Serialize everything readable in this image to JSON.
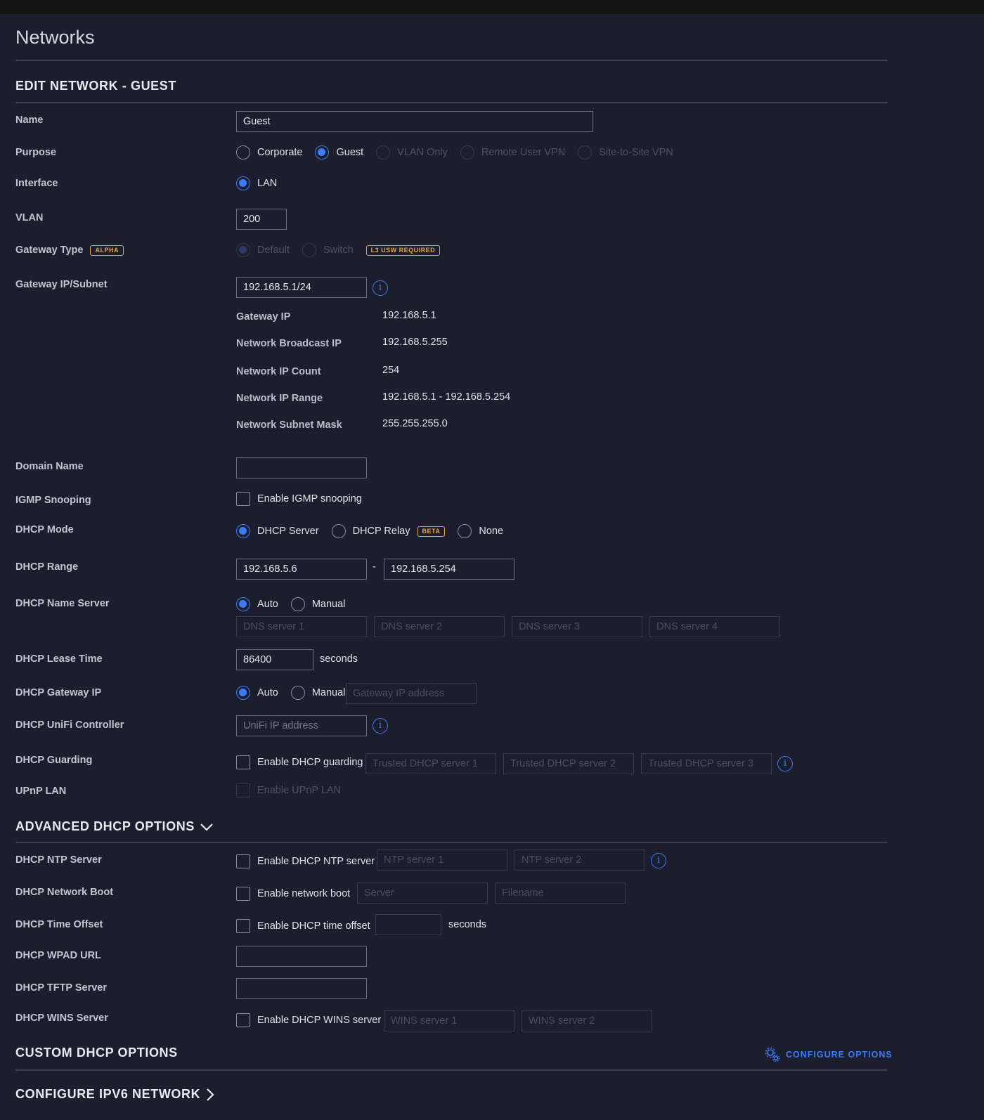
{
  "page": {
    "title": "Networks"
  },
  "edit": {
    "title": "EDIT NETWORK - GUEST",
    "name": {
      "label": "Name",
      "value": "Guest"
    },
    "purpose": {
      "label": "Purpose",
      "options": [
        "Corporate",
        "Guest",
        "VLAN Only",
        "Remote User VPN",
        "Site-to-Site VPN"
      ],
      "selected": "Guest"
    },
    "interface": {
      "label": "Interface",
      "option": "LAN"
    },
    "vlan": {
      "label": "VLAN",
      "value": "200"
    },
    "gateway_type": {
      "label": "Gateway Type",
      "badge": "ALPHA",
      "options": [
        "Default",
        "Switch"
      ],
      "switch_badge": "L3 USW REQUIRED"
    },
    "gateway_subnet": {
      "label": "Gateway IP/Subnet",
      "value": "192.168.5.1/24"
    },
    "details": [
      {
        "label": "Gateway IP",
        "value": "192.168.5.1"
      },
      {
        "label": "Network Broadcast IP",
        "value": "192.168.5.255"
      },
      {
        "label": "Network IP Count",
        "value": "254"
      },
      {
        "label": "Network IP Range",
        "value": "192.168.5.1 - 192.168.5.254"
      },
      {
        "label": "Network Subnet Mask",
        "value": "255.255.255.0"
      }
    ],
    "domain_name": {
      "label": "Domain Name",
      "value": ""
    },
    "igmp": {
      "label": "IGMP Snooping",
      "checkbox": "Enable IGMP snooping"
    },
    "dhcp_mode": {
      "label": "DHCP Mode",
      "options": [
        "DHCP Server",
        "DHCP Relay",
        "None"
      ],
      "relay_badge": "BETA",
      "selected": "DHCP Server"
    },
    "dhcp_range": {
      "label": "DHCP Range",
      "start": "192.168.5.6",
      "separator": "-",
      "end": "192.168.5.254"
    },
    "dhcp_name_server": {
      "label": "DHCP Name Server",
      "options": [
        "Auto",
        "Manual"
      ],
      "selected": "Auto",
      "placeholders": [
        "DNS server 1",
        "DNS server 2",
        "DNS server 3",
        "DNS server 4"
      ]
    },
    "dhcp_lease": {
      "label": "DHCP Lease Time",
      "value": "86400",
      "unit": "seconds"
    },
    "dhcp_gateway": {
      "label": "DHCP Gateway IP",
      "options": [
        "Auto",
        "Manual"
      ],
      "selected": "Auto",
      "placeholder": "Gateway IP address"
    },
    "dhcp_unifi": {
      "label": "DHCP UniFi Controller",
      "placeholder": "UniFi IP address"
    },
    "dhcp_guarding": {
      "label": "DHCP Guarding",
      "checkbox": "Enable DHCP guarding",
      "placeholders": [
        "Trusted DHCP server 1",
        "Trusted DHCP server 2",
        "Trusted DHCP server 3"
      ]
    },
    "upnp": {
      "label": "UPnP LAN",
      "checkbox": "Enable UPnP LAN"
    }
  },
  "advanced": {
    "title": "ADVANCED DHCP OPTIONS",
    "ntp": {
      "label": "DHCP NTP Server",
      "checkbox": "Enable DHCP NTP server",
      "placeholders": [
        "NTP server 1",
        "NTP server 2"
      ]
    },
    "boot": {
      "label": "DHCP Network Boot",
      "checkbox": "Enable network boot",
      "placeholders": [
        "Server",
        "Filename"
      ]
    },
    "offset": {
      "label": "DHCP Time Offset",
      "checkbox": "Enable DHCP time offset",
      "unit": "seconds"
    },
    "wpad": {
      "label": "DHCP WPAD URL"
    },
    "tftp": {
      "label": "DHCP TFTP Server"
    },
    "wins": {
      "label": "DHCP WINS Server",
      "checkbox": "Enable DHCP WINS server",
      "placeholders": [
        "WINS server 1",
        "WINS server 2"
      ]
    }
  },
  "custom": {
    "title": "CUSTOM DHCP OPTIONS",
    "configure": "CONFIGURE OPTIONS"
  },
  "ipv6": {
    "title": "CONFIGURE IPV6 NETWORK"
  },
  "colors": {
    "background": "#1c1e2e",
    "accent": "#3b7cf5",
    "badge": "#e6a640"
  }
}
